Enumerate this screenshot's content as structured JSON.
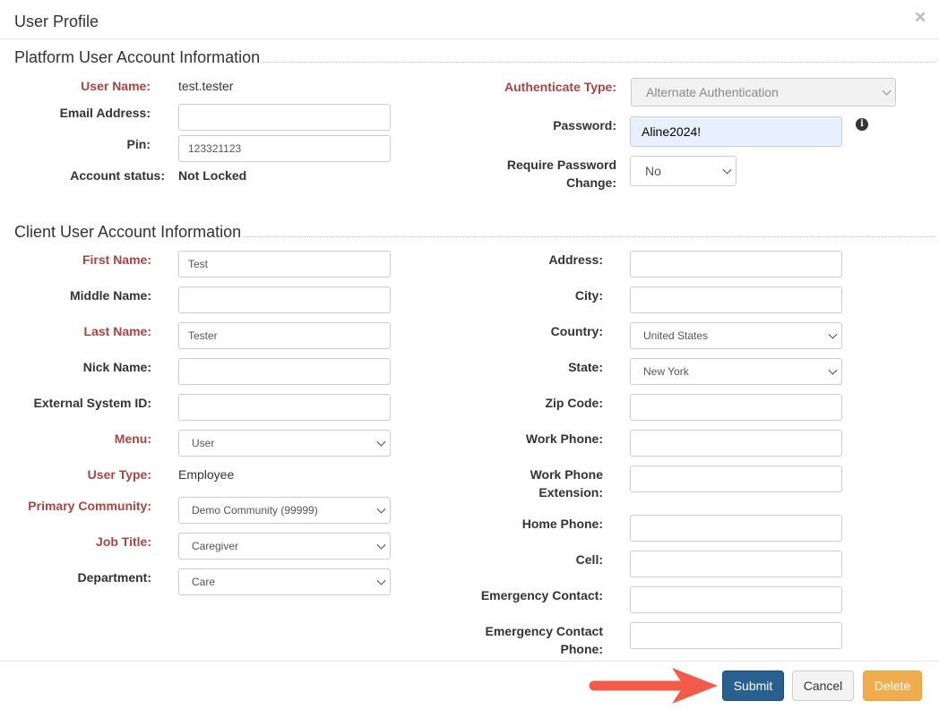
{
  "dialog": {
    "title": "User Profile",
    "close_icon": "close-icon"
  },
  "platform": {
    "heading": "Platform User Account Information",
    "user_name": {
      "label": "User Name:",
      "value": "test.tester"
    },
    "email": {
      "label": "Email Address:",
      "value": ""
    },
    "pin": {
      "label": "Pin:",
      "value": "123321123"
    },
    "account_status": {
      "label": "Account status:",
      "value": "Not Locked"
    },
    "authenticate_type": {
      "label": "Authenticate Type:",
      "value": "Alternate Authentication",
      "disabled": true
    },
    "password": {
      "label": "Password:",
      "value": "Aline2024!",
      "info_icon": "info-circle-icon"
    },
    "require_password_change": {
      "label_line1": "Require Password",
      "label_line2": "Change:",
      "value": "No"
    }
  },
  "client": {
    "heading": "Client User Account Information",
    "left": [
      {
        "label": "First Name:",
        "value": "Test",
        "type": "input",
        "required": true
      },
      {
        "label": "Middle Name:",
        "value": "",
        "type": "input"
      },
      {
        "label": "Last Name:",
        "value": "Tester",
        "type": "input",
        "required": true
      },
      {
        "label": "Nick Name:",
        "value": "",
        "type": "input"
      },
      {
        "label": "External System ID:",
        "value": "",
        "type": "input"
      },
      {
        "label": "Menu:",
        "value": "User",
        "type": "select",
        "required": true
      },
      {
        "label": "User Type:",
        "value": "Employee",
        "type": "text",
        "required": true
      },
      {
        "label": "Primary Community:",
        "value": "Demo Community (99999)",
        "type": "select",
        "required": true
      },
      {
        "label": "Job Title:",
        "value": "Caregiver",
        "type": "select",
        "required": true
      },
      {
        "label": "Department:",
        "value": "Care",
        "type": "select"
      }
    ],
    "right": [
      {
        "label": "Address:",
        "value": "",
        "type": "input"
      },
      {
        "label": "City:",
        "value": "",
        "type": "input"
      },
      {
        "label": "Country:",
        "value": "United States",
        "type": "select"
      },
      {
        "label": "State:",
        "value": "New York",
        "type": "select"
      },
      {
        "label": "Zip Code:",
        "value": "",
        "type": "input"
      },
      {
        "label": "Work Phone:",
        "value": "",
        "type": "input"
      },
      {
        "label": "Work Phone Extension:",
        "value": "",
        "type": "input"
      },
      {
        "label": "Home Phone:",
        "value": "",
        "type": "input"
      },
      {
        "label": "Cell:",
        "value": "",
        "type": "input"
      },
      {
        "label": "Emergency Contact:",
        "value": "",
        "type": "input"
      },
      {
        "label": "Emergency Contact Phone:",
        "value": "",
        "type": "input"
      }
    ]
  },
  "footer": {
    "submit": "Submit",
    "cancel": "Cancel",
    "delete": "Delete"
  },
  "colors": {
    "required_label": "#a94442",
    "submit": "#286090",
    "delete": "#f0ad4e",
    "annotation_arrow": "#f25a4a",
    "password_bg": "#e8f0fe"
  }
}
